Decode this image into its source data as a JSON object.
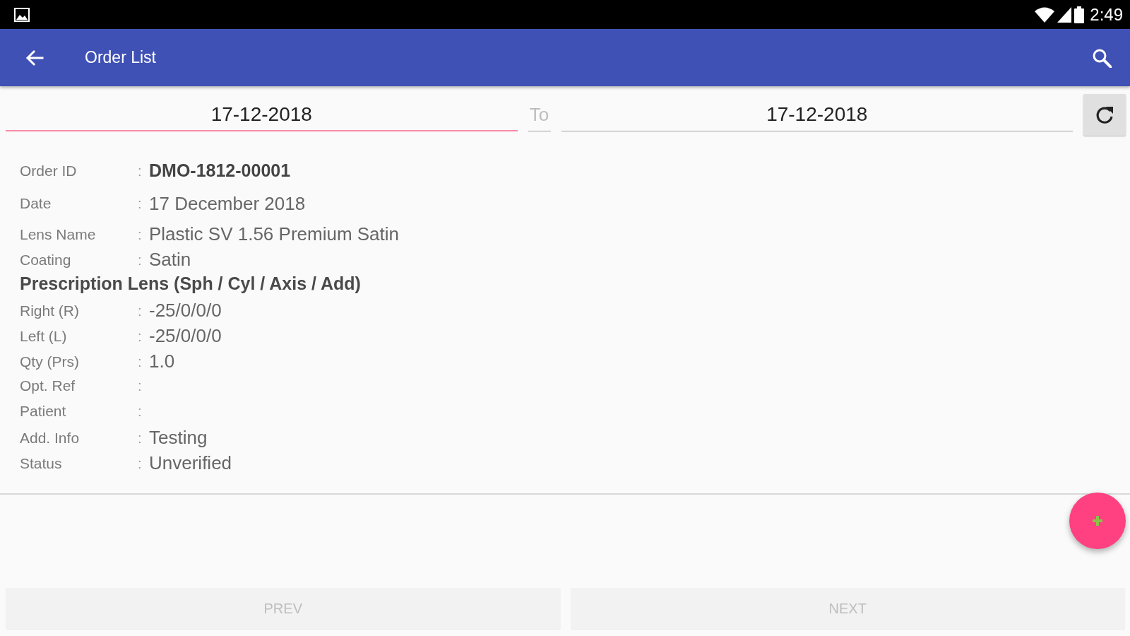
{
  "status_bar": {
    "time": "2:49"
  },
  "app_bar": {
    "title": "Order List"
  },
  "date_range": {
    "from": {
      "value": "17-12-2018",
      "focused": true
    },
    "separator": "To",
    "to": {
      "value": "17-12-2018",
      "focused": false
    }
  },
  "order_details": {
    "order_id": {
      "label": "Order ID",
      "separator": ":",
      "value": "DMO-1812-00001"
    },
    "rows": [
      {
        "kind": "field",
        "label": "Date",
        "separator": ":",
        "value": "17 December 2018"
      },
      {
        "kind": "field",
        "label": "Lens Name",
        "separator": ":",
        "value": "Plastic SV 1.56 Premium Satin"
      },
      {
        "kind": "field",
        "label": "Coating",
        "separator": ":",
        "value": "Satin"
      },
      {
        "kind": "heading",
        "label": "Prescription Lens (Sph / Cyl / Axis / Add)"
      },
      {
        "kind": "field",
        "label": "Right (R)",
        "separator": ":",
        "value": "-25/0/0/0"
      },
      {
        "kind": "field",
        "label": "Left (L)",
        "separator": ":",
        "value": "-25/0/0/0"
      },
      {
        "kind": "field",
        "label": "Qty (Prs)",
        "separator": ":",
        "value": "1.0"
      },
      {
        "kind": "field",
        "label": "Opt. Ref",
        "separator": ":"
      },
      {
        "kind": "field",
        "label": "Patient",
        "separator": ":"
      },
      {
        "kind": "field",
        "label": "Add. Info",
        "separator": ":",
        "value": "Testing"
      },
      {
        "kind": "field",
        "label": "Status",
        "separator": ":",
        "value": "Unverified"
      }
    ]
  },
  "pager": [
    {
      "label": "PREV",
      "disabled": true
    },
    {
      "label": "NEXT",
      "disabled": true
    }
  ]
}
